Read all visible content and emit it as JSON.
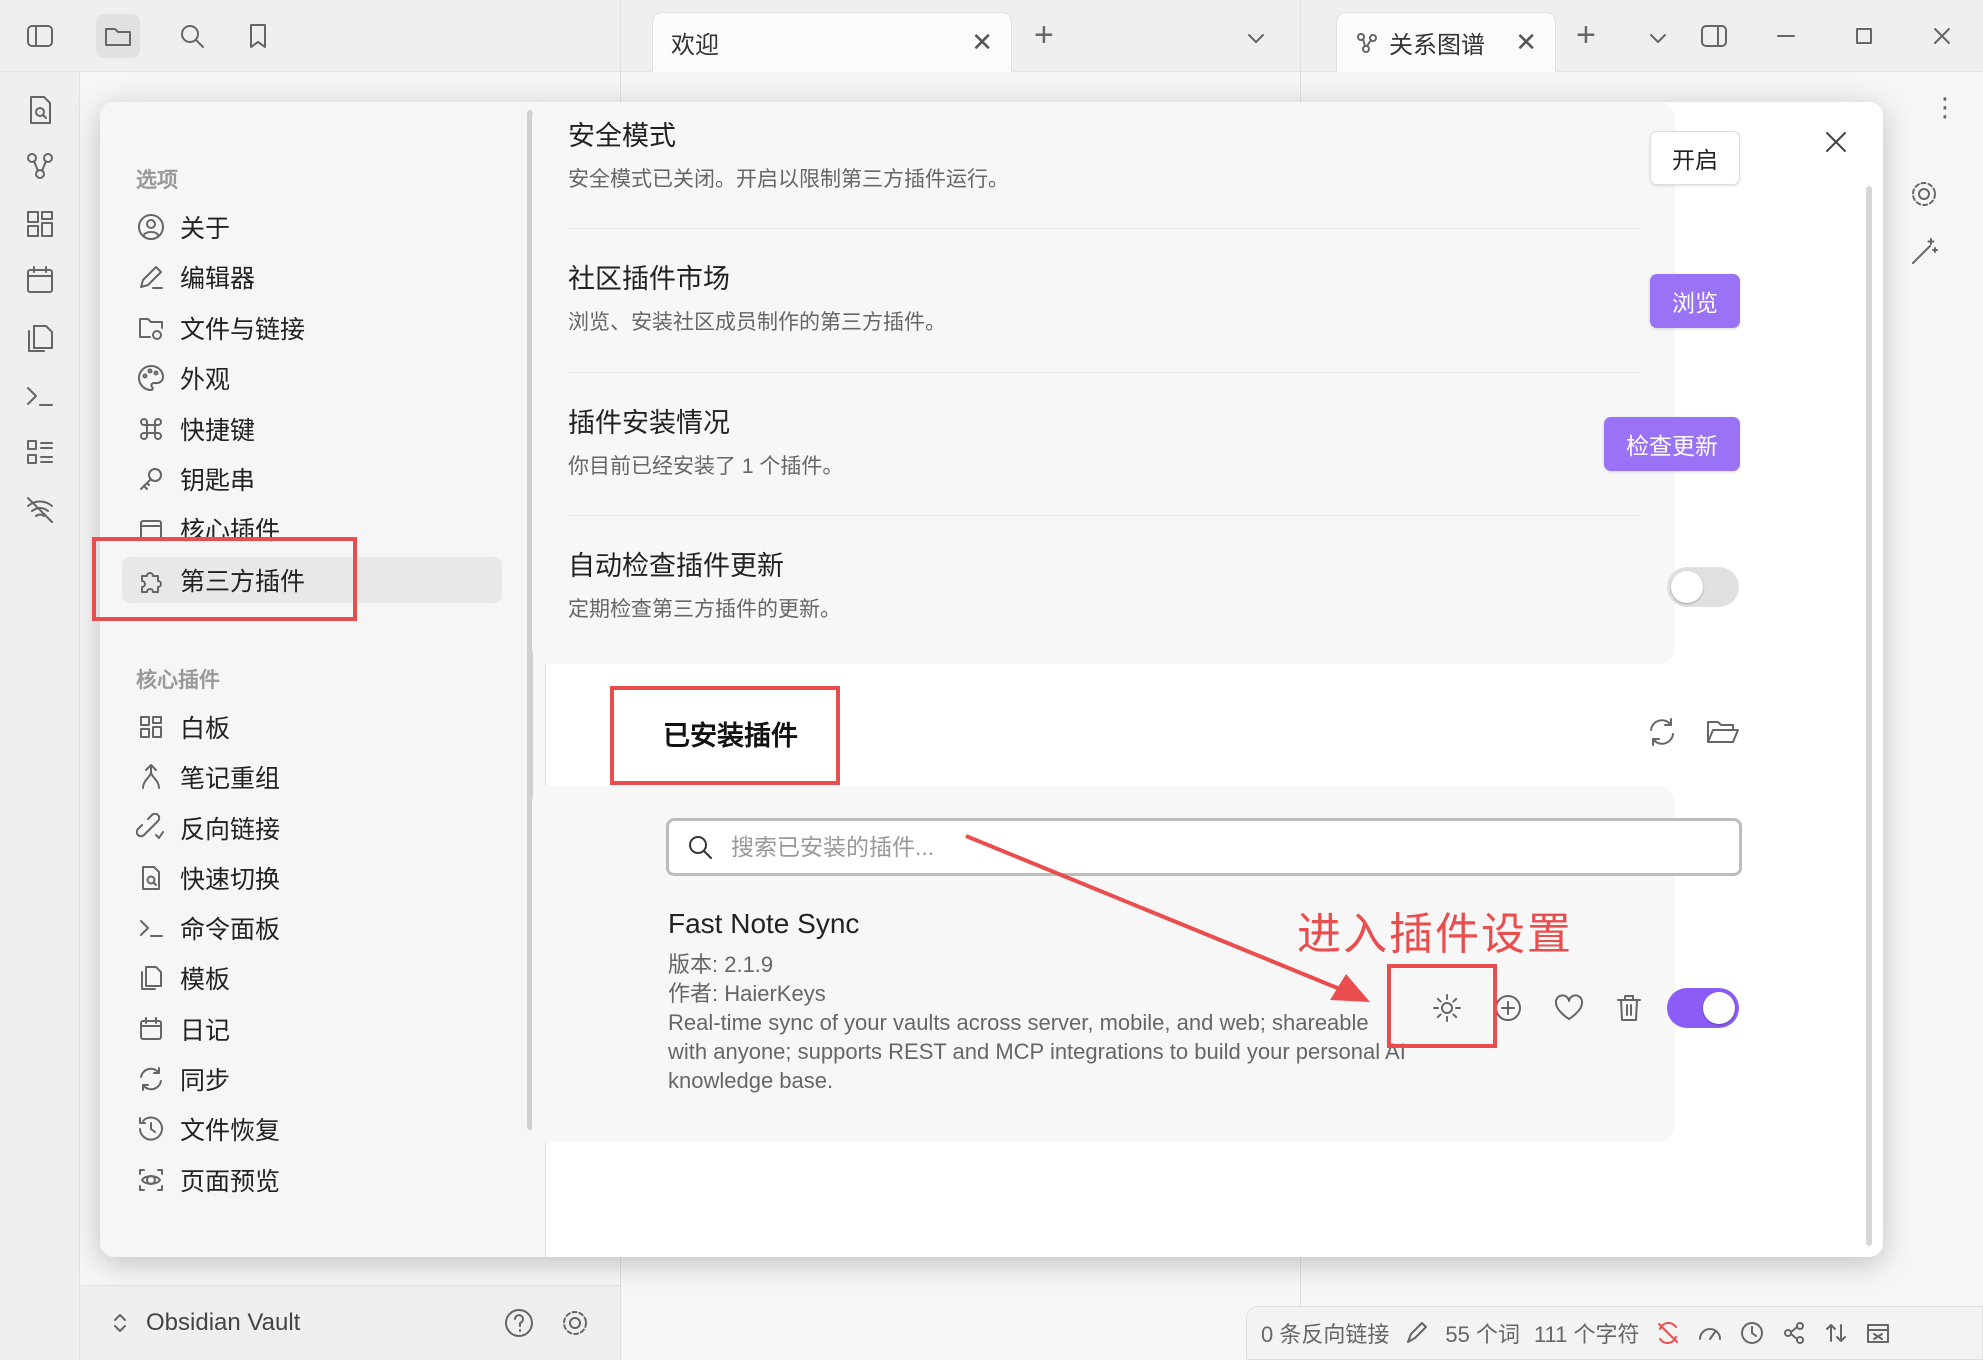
{
  "tabs": [
    {
      "label": "欢迎",
      "close": "✕"
    },
    {
      "label": "关系图谱",
      "close": "✕"
    }
  ],
  "new_tab": "+",
  "vault_name": "Obsidian Vault",
  "status": {
    "backlinks": "0 条反向链接",
    "words": "55 个词",
    "chars": "111 个字符"
  },
  "settings": {
    "sections": [
      {
        "title": "选项",
        "items": [
          {
            "label": "关于",
            "icon": "user-circle-icon"
          },
          {
            "label": "编辑器",
            "icon": "pencil-icon"
          },
          {
            "label": "文件与链接",
            "icon": "folder-link-icon"
          },
          {
            "label": "外观",
            "icon": "palette-icon"
          },
          {
            "label": "快捷键",
            "icon": "command-icon"
          },
          {
            "label": "钥匙串",
            "icon": "key-icon"
          },
          {
            "label": "核心插件",
            "icon": "calendar-plugin-icon"
          },
          {
            "label": "第三方插件",
            "icon": "puzzle-icon",
            "active": true
          }
        ]
      },
      {
        "title": "核心插件",
        "items": [
          {
            "label": "白板",
            "icon": "canvas-icon"
          },
          {
            "label": "笔记重组",
            "icon": "merge-icon"
          },
          {
            "label": "反向链接",
            "icon": "backlink-icon"
          },
          {
            "label": "快速切换",
            "icon": "file-search-icon"
          },
          {
            "label": "命令面板",
            "icon": "terminal-icon"
          },
          {
            "label": "模板",
            "icon": "template-icon"
          },
          {
            "label": "日记",
            "icon": "calendar-icon"
          },
          {
            "label": "同步",
            "icon": "sync-icon"
          },
          {
            "label": "文件恢复",
            "icon": "history-icon"
          },
          {
            "label": "页面预览",
            "icon": "preview-icon"
          }
        ]
      }
    ],
    "rows": [
      {
        "title": "安全模式",
        "desc": "安全模式已关闭。开启以限制第三方插件运行。",
        "button": "开启",
        "button_style": "plain"
      },
      {
        "title": "社区插件市场",
        "desc": "浏览、安装社区成员制作的第三方插件。",
        "button": "浏览",
        "button_style": "accent"
      },
      {
        "title": "插件安装情况",
        "desc": "你目前已经安装了 1 个插件。",
        "button": "检查更新",
        "button_style": "accent"
      },
      {
        "title": "自动检查插件更新",
        "desc": "定期检查第三方插件的更新。",
        "toggle": false
      }
    ],
    "installed_heading": "已安装插件",
    "search_placeholder": "搜索已安装的插件...",
    "plugin": {
      "name": "Fast Note Sync",
      "version": "版本: 2.1.9",
      "author": "作者:  HaierKeys",
      "description": "Real-time sync of your vaults across server, mobile, and web; shareable with anyone; supports REST and MCP integrations to build your personal AI knowledge base.",
      "enabled": true
    }
  },
  "annotation": {
    "text": "进入插件设置",
    "color": "#e94d4d"
  },
  "colors": {
    "accent": "#9a72f6",
    "annotation": "#e94d4d"
  }
}
